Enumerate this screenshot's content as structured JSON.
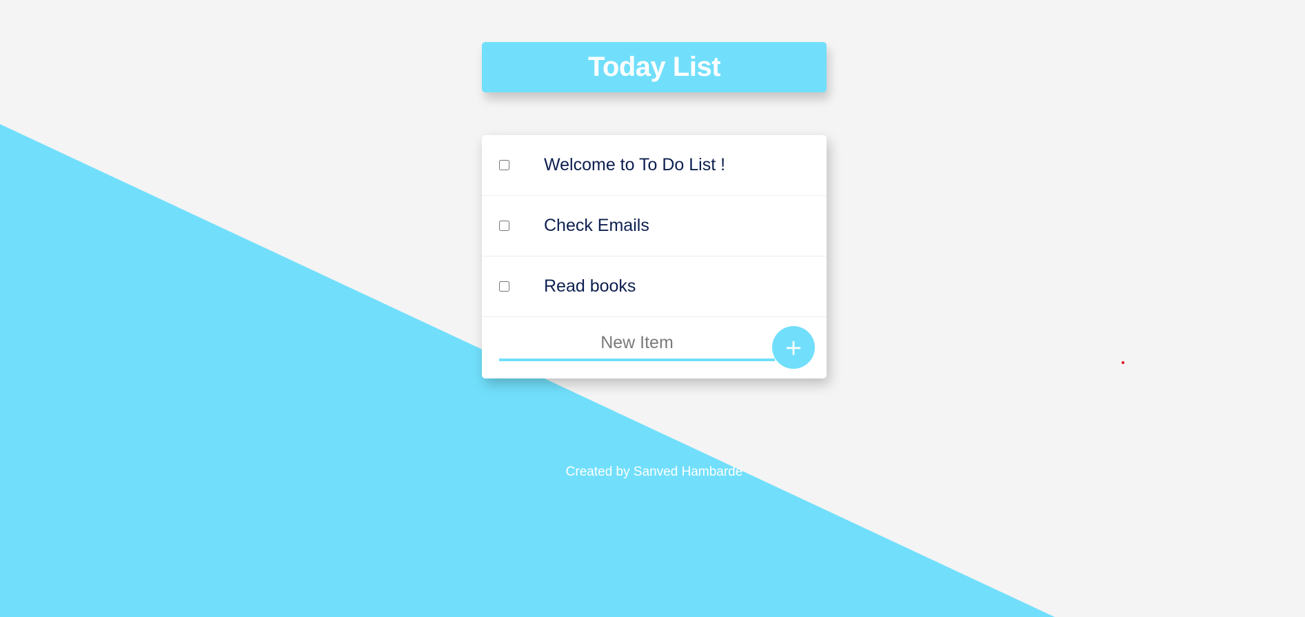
{
  "header": {
    "title": "Today List"
  },
  "items": [
    {
      "text": "Welcome to To Do List !",
      "checked": false
    },
    {
      "text": "Check Emails",
      "checked": false
    },
    {
      "text": "Read books",
      "checked": false
    }
  ],
  "new_item": {
    "placeholder": "New Item",
    "value": ""
  },
  "add_button": {
    "label": "+"
  },
  "footer": {
    "text": "Created by Sanved Hambarde"
  },
  "colors": {
    "accent": "#71dffb",
    "background": "#f4f4f4",
    "text": "#0c1f4f"
  }
}
